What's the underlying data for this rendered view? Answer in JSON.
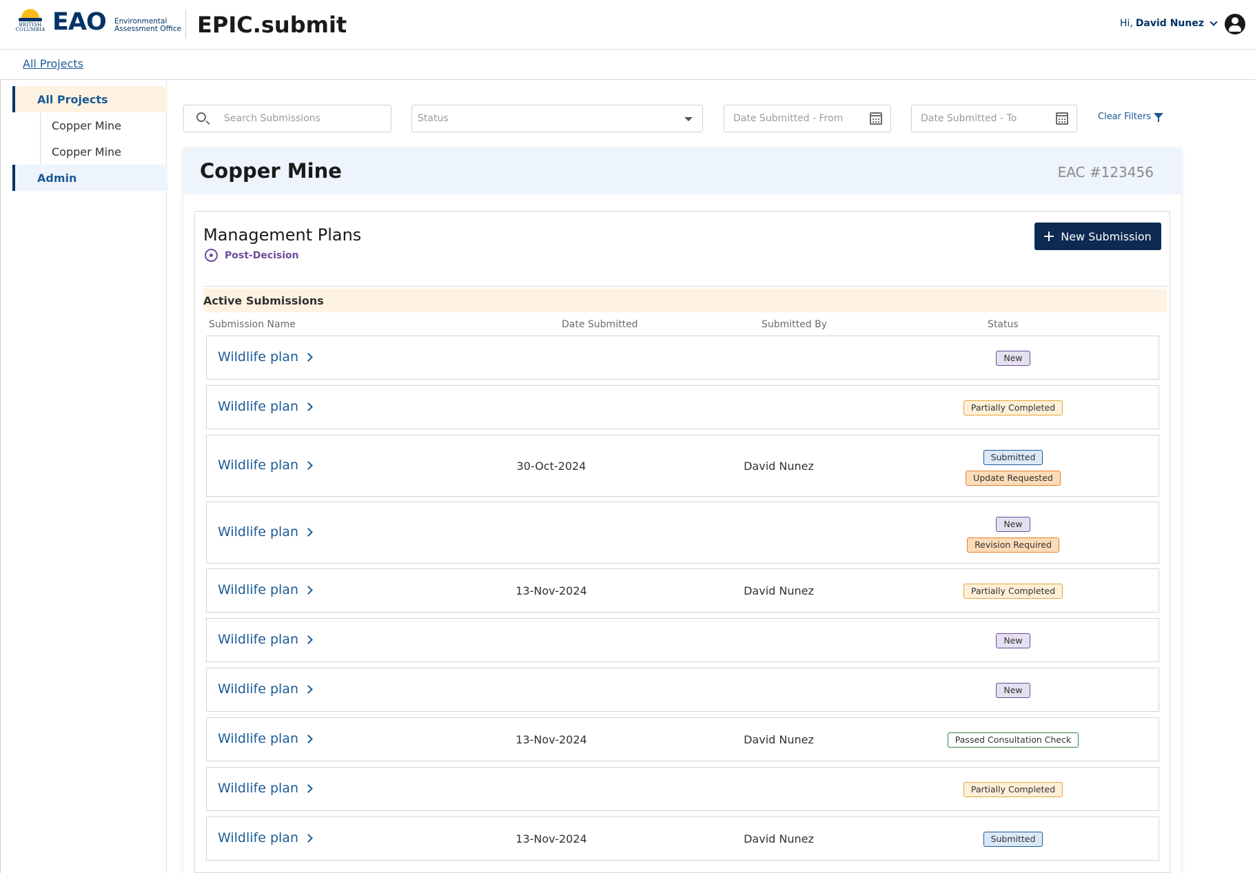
{
  "header": {
    "bc_logo_text": "BRITISH COLUMBIA",
    "org_short": "EAO",
    "org_line1": "Environmental",
    "org_line2": "Assessment Office",
    "app_title": "EPIC.submit",
    "greeting": "Hi,",
    "user_name": "David Nunez"
  },
  "breadcrumb": {
    "label": "All Projects"
  },
  "sidebar": {
    "items": [
      {
        "label": "All Projects"
      },
      {
        "label": "Copper Mine"
      },
      {
        "label": "Copper Mine"
      },
      {
        "label": "Admin"
      }
    ]
  },
  "filters": {
    "search_placeholder": "Search Submissions",
    "status_placeholder": "Status",
    "date_from_placeholder": "Date Submitted - From",
    "date_to_placeholder": "Date Submitted - To",
    "clear_label": "Clear Filters"
  },
  "project": {
    "name": "Copper Mine",
    "eac": "EAC #123456",
    "section_title": "Management Plans",
    "phase": "Post-Decision",
    "new_submission_label": "New Submission",
    "group_label": "Active Submissions",
    "columns": [
      "Submission Name",
      "Date Submitted",
      "Submitted By",
      "Status"
    ],
    "rows": [
      {
        "name": "Wildlife plan",
        "date": "",
        "by": "",
        "statuses": [
          "New"
        ]
      },
      {
        "name": "Wildlife plan",
        "date": "",
        "by": "",
        "statuses": [
          "Partially Completed"
        ]
      },
      {
        "name": "Wildlife plan",
        "date": "30-Oct-2024",
        "by": "David Nunez",
        "statuses": [
          "Submitted",
          "Update Requested"
        ]
      },
      {
        "name": "Wildlife plan",
        "date": "",
        "by": "",
        "statuses": [
          "New",
          "Revision Required"
        ]
      },
      {
        "name": "Wildlife plan",
        "date": "13-Nov-2024",
        "by": "David Nunez",
        "statuses": [
          "Partially Completed"
        ]
      },
      {
        "name": "Wildlife plan",
        "date": "",
        "by": "",
        "statuses": [
          "New"
        ]
      },
      {
        "name": "Wildlife plan",
        "date": "",
        "by": "",
        "statuses": [
          "New"
        ]
      },
      {
        "name": "Wildlife plan",
        "date": "13-Nov-2024",
        "by": "David Nunez",
        "statuses": [
          "Passed Consultation Check"
        ]
      },
      {
        "name": "Wildlife plan",
        "date": "",
        "by": "",
        "statuses": [
          "Partially Completed"
        ]
      },
      {
        "name": "Wildlife plan",
        "date": "13-Nov-2024",
        "by": "David Nunez",
        "statuses": [
          "Submitted"
        ]
      }
    ]
  },
  "colors": {
    "brand_navy": "#003366",
    "link_blue": "#1a5a96",
    "button_navy": "#0c2a52",
    "highlight_cream": "#fef3e2",
    "phase_purple": "#6b4c9a"
  }
}
